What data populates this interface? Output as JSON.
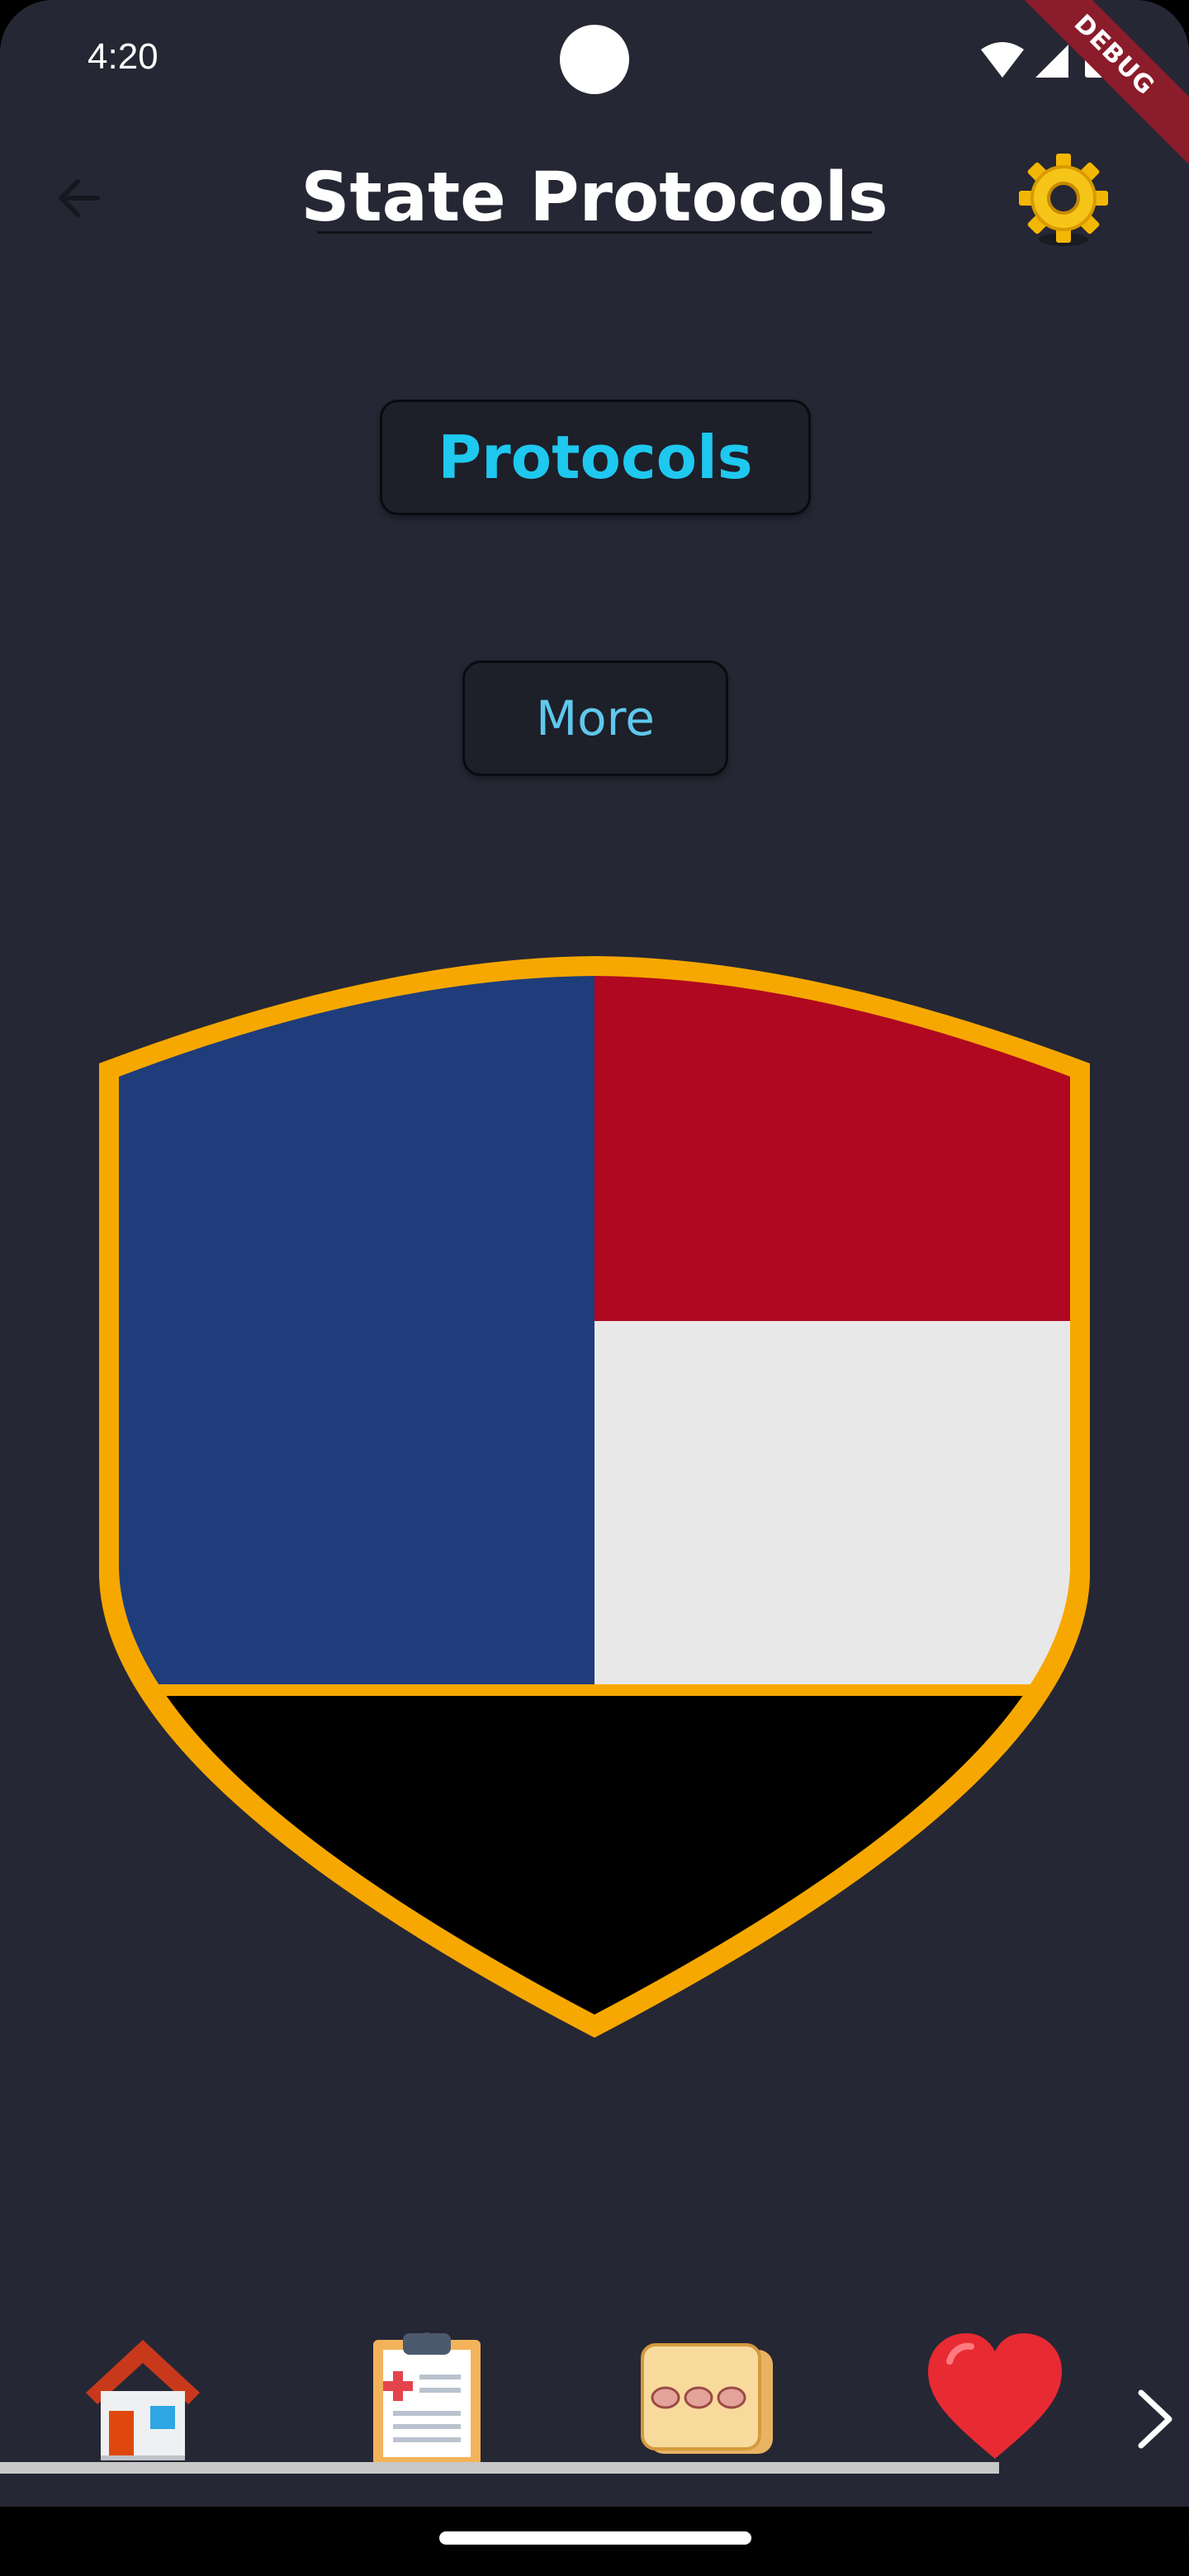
{
  "status_bar": {
    "time": "4:20",
    "icons": [
      "wifi-icon",
      "signal-icon",
      "battery-icon"
    ],
    "debug_banner": "DEBUG"
  },
  "app_bar": {
    "back_icon": "arrow-left-icon",
    "title": "State Protocols",
    "settings_icon": "gear-icon"
  },
  "buttons": {
    "protocols_label": "Protocols",
    "more_label": "More"
  },
  "emblem": {
    "description_icon": "state-shield-icon",
    "colors": {
      "border": "#f6a800",
      "blue": "#1f3d7a",
      "red": "#b00821",
      "white": "#e8e8e8",
      "black": "#000000"
    }
  },
  "bottom_nav": {
    "items": [
      {
        "name": "home",
        "icon": "house-icon"
      },
      {
        "name": "protocols",
        "icon": "clipboard-medical-icon"
      },
      {
        "name": "meds",
        "icon": "pill-pack-icon"
      },
      {
        "name": "favorites",
        "icon": "heart-icon"
      }
    ],
    "next_icon": "chevron-right-icon"
  },
  "theme": {
    "background": "#262734",
    "accent": "#1ec8ef"
  }
}
